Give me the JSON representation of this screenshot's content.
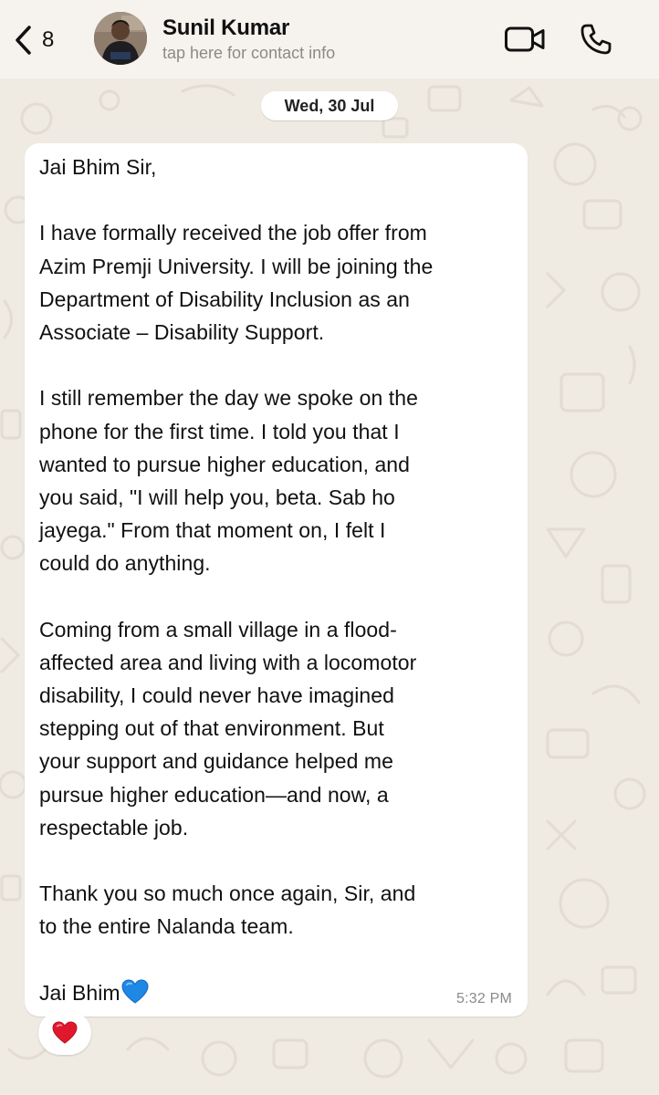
{
  "header": {
    "back_count": "8",
    "contact_name": "Sunil Kumar",
    "contact_subtitle": "tap here for contact info"
  },
  "conversation": {
    "date_label": "Wed, 30 Jul",
    "message": {
      "lines": [
        "Jai Bhim Sir,",
        "",
        "I have formally received the job offer from",
        "Azim Premji University. I will be joining the",
        "Department of Disability Inclusion as an",
        "Associate – Disability Support.",
        "",
        "I still remember the day we spoke on the",
        "phone for the first time. I told you that I",
        "wanted to pursue higher education, and",
        "you said, \"I will help you, beta. Sab ho",
        "jayega.\" From that moment on, I felt I",
        "could do anything.",
        "",
        "Coming from a small village in a flood-",
        "affected area and living with a locomotor",
        "disability, I could never have imagined",
        "stepping out of that environment. But",
        "your support and guidance helped me",
        "pursue higher education—and now, a",
        "respectable job.",
        "",
        "Thank you so much once again, Sir, and",
        "to the entire Nalanda team.",
        ""
      ],
      "last_line": "Jai Bhim",
      "last_line_emoji": "blue-heart",
      "time": "5:32 PM",
      "reaction": "red-heart"
    }
  },
  "colors": {
    "wallpaper": "#efeae2",
    "bubble": "#ffffff",
    "blue_heart": "#1e88e5",
    "red_heart": "#e0182d"
  }
}
